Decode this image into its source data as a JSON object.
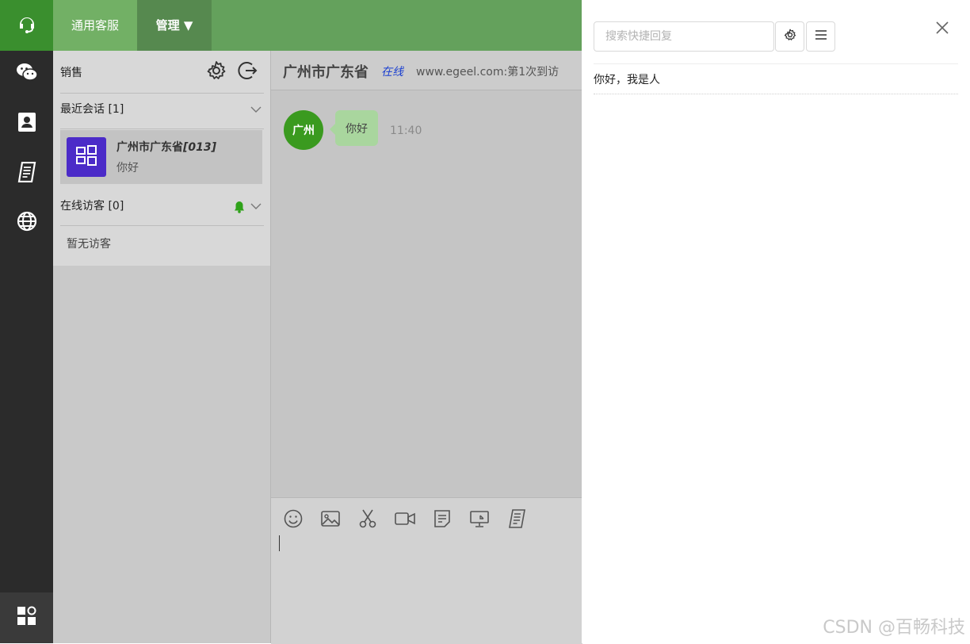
{
  "topbar": {
    "tab_general": "通用客服",
    "tab_manage": "管理 ▼"
  },
  "rail": {
    "items": [
      "headset-icon",
      "wechat-icon",
      "contacts-icon",
      "notes-icon",
      "globe-icon"
    ],
    "bottom": "apps-icon"
  },
  "sidebar": {
    "title": "销售",
    "recent_label": "最近会话 [1]",
    "conversation": {
      "name": "广州市广东省",
      "id": "[013]",
      "last_message": "你好"
    },
    "online_label": "在线访客 [0]",
    "no_visitors": "暂无访客"
  },
  "chat": {
    "visitor": "广州市广东省",
    "status": "在线",
    "site_info": "www.egeel.com:第1次到访",
    "avatar_text": "广州",
    "message": "你好",
    "time": "11:40",
    "toolbar": [
      "smile-icon",
      "image-icon",
      "scissors-icon",
      "video-icon",
      "note-icon",
      "screen-icon",
      "receipt-icon"
    ]
  },
  "drawer": {
    "search_placeholder": "搜索快捷回复",
    "reply_item": "你好，我是人"
  },
  "watermark": "CSDN @百畅科技",
  "colors": {
    "brand_green": "#64a15c",
    "avatar_purple": "#4b2bc8",
    "online_blue": "#1a3fd0"
  }
}
